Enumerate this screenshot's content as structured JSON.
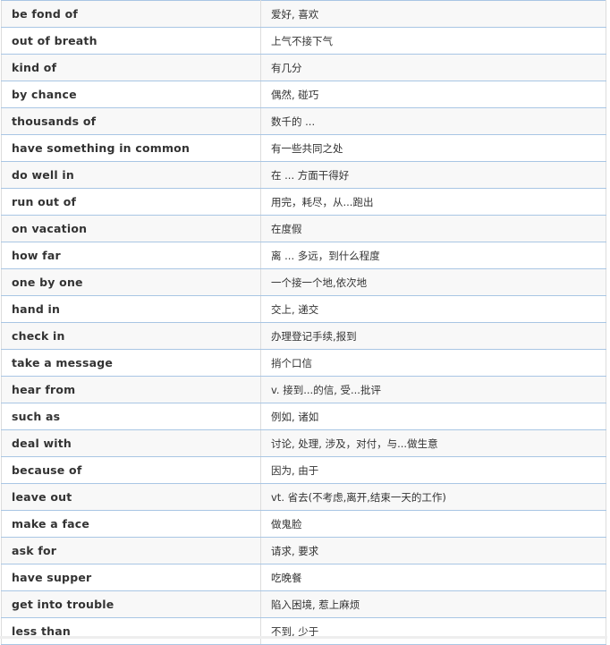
{
  "vocab_table": {
    "rows": [
      {
        "phrase": "be fond of",
        "meaning": "爱好, 喜欢"
      },
      {
        "phrase": "out of breath",
        "meaning": "上气不接下气"
      },
      {
        "phrase": "kind of",
        "meaning": "有几分"
      },
      {
        "phrase": "by chance",
        "meaning": "偶然, 碰巧"
      },
      {
        "phrase": "thousands of",
        "meaning": "数千的 ..."
      },
      {
        "phrase": "have something in common",
        "meaning": "有一些共同之处"
      },
      {
        "phrase": "do well in",
        "meaning": "在 ... 方面干得好"
      },
      {
        "phrase": "run out of",
        "meaning": "用完，耗尽，从...跑出"
      },
      {
        "phrase": "on vacation",
        "meaning": "在度假"
      },
      {
        "phrase": "how far",
        "meaning": "离 ... 多远，到什么程度"
      },
      {
        "phrase": "one by one",
        "meaning": "一个接一个地,依次地"
      },
      {
        "phrase": "hand in",
        "meaning": "交上, 递交"
      },
      {
        "phrase": "check in",
        "meaning": "办理登记手续,报到"
      },
      {
        "phrase": "take a message",
        "meaning": "捎个口信"
      },
      {
        "phrase": "hear from",
        "meaning": "v. 接到...的信,  受...批评"
      },
      {
        "phrase": "such as",
        "meaning": "例如, 诸如"
      },
      {
        "phrase": "deal with",
        "meaning": "讨论, 处理,  涉及，对付，与...做生意"
      },
      {
        "phrase": "because of",
        "meaning": "因为, 由于"
      },
      {
        "phrase": "leave out",
        "meaning": "vt. 省去(不考虑,离开,结束一天的工作)"
      },
      {
        "phrase": "make a face",
        "meaning": "做鬼脸"
      },
      {
        "phrase": "ask for",
        "meaning": "请求, 要求"
      },
      {
        "phrase": "have supper",
        "meaning": "吃晚餐"
      },
      {
        "phrase": "get into trouble",
        "meaning": "陷入困境, 惹上麻烦"
      },
      {
        "phrase": "less than",
        "meaning": "不到, 少于"
      }
    ]
  }
}
